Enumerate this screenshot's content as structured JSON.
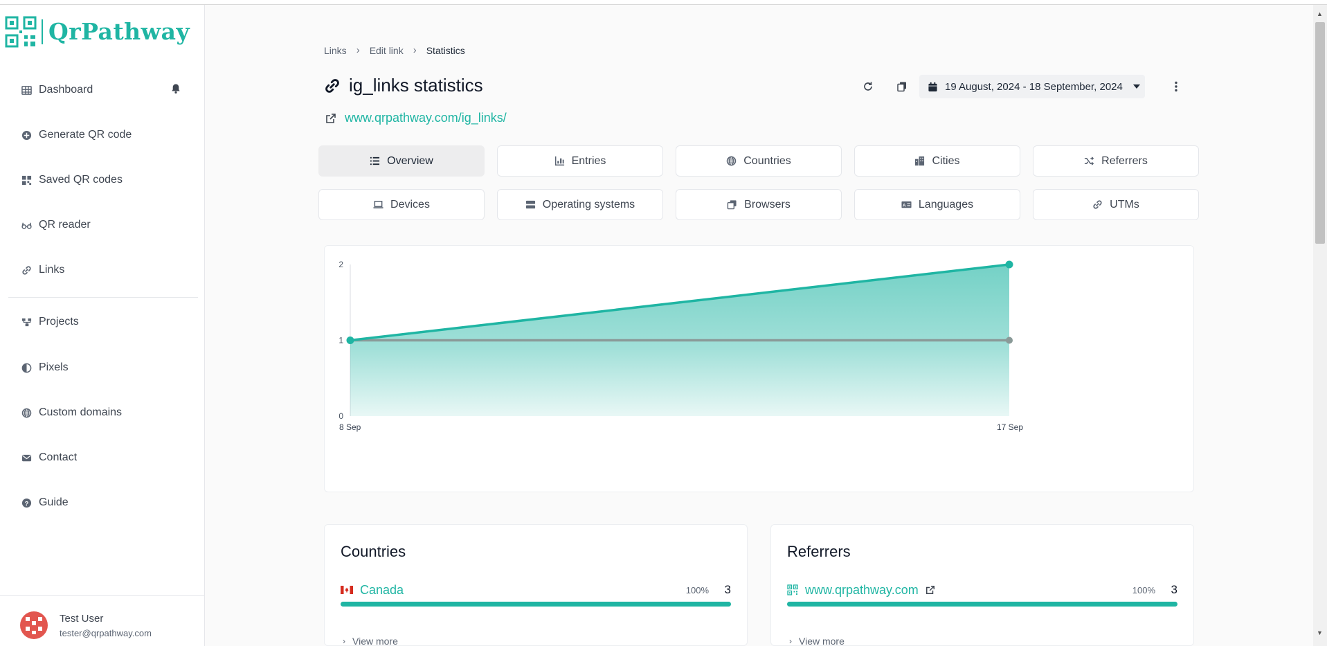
{
  "brand": {
    "name": "QrPathway",
    "color": "#1fb5a3"
  },
  "sidebar": {
    "items": [
      {
        "label": "Dashboard",
        "icon": "grid-icon"
      },
      {
        "label": "Generate QR code",
        "icon": "plus-circle-icon"
      },
      {
        "label": "Saved QR codes",
        "icon": "qr-icon"
      },
      {
        "label": "QR reader",
        "icon": "glasses-icon"
      },
      {
        "label": "Links",
        "icon": "link-icon"
      },
      {
        "label": "Projects",
        "icon": "project-icon"
      },
      {
        "label": "Pixels",
        "icon": "adjust-icon"
      },
      {
        "label": "Custom domains",
        "icon": "globe-icon"
      },
      {
        "label": "Contact",
        "icon": "envelope-icon"
      },
      {
        "label": "Guide",
        "icon": "question-icon"
      }
    ]
  },
  "user": {
    "name": "Test User",
    "email": "tester@qrpathway.com"
  },
  "breadcrumb": {
    "links": "Links",
    "edit": "Edit link",
    "current": "Statistics"
  },
  "page": {
    "title": "ig_links statistics",
    "url": "www.qrpathway.com/ig_links/",
    "date_range": "19 August, 2024 - 18 September, 2024"
  },
  "tabs": [
    {
      "label": "Overview",
      "icon": "list-icon",
      "active": true
    },
    {
      "label": "Entries",
      "icon": "chart-icon"
    },
    {
      "label": "Countries",
      "icon": "globe-icon"
    },
    {
      "label": "Cities",
      "icon": "city-icon"
    },
    {
      "label": "Referrers",
      "icon": "shuffle-icon"
    },
    {
      "label": "Devices",
      "icon": "laptop-icon"
    },
    {
      "label": "Operating systems",
      "icon": "server-icon"
    },
    {
      "label": "Browsers",
      "icon": "windows-icon"
    },
    {
      "label": "Languages",
      "icon": "language-icon"
    },
    {
      "label": "UTMs",
      "icon": "link-icon"
    }
  ],
  "chart_data": {
    "type": "area",
    "x": [
      "8 Sep",
      "17 Sep"
    ],
    "series": [
      {
        "values": [
          1,
          2
        ],
        "color": "#1fb5a3"
      },
      {
        "values": [
          1,
          1
        ],
        "color": "#8a9a98"
      }
    ],
    "yticks": [
      "2",
      "1",
      "0"
    ],
    "ylim": [
      0,
      2
    ],
    "grid": false
  },
  "countries": {
    "title": "Countries",
    "rows": [
      {
        "name": "Canada",
        "percent": "100%",
        "count": "3",
        "fraction": 1.0
      }
    ],
    "view_more": "View more"
  },
  "referrers": {
    "title": "Referrers",
    "rows": [
      {
        "name": "www.qrpathway.com",
        "percent": "100%",
        "count": "3",
        "fraction": 1.0
      }
    ],
    "view_more": "View more"
  }
}
